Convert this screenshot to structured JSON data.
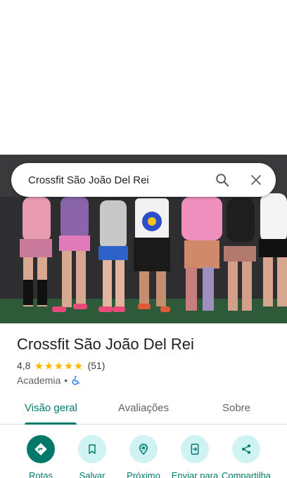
{
  "search": {
    "query": "Crossfit São João Del Rei"
  },
  "place": {
    "name": "Crossfit São João Del Rei",
    "rating": "4,8",
    "rating_value": 4.8,
    "stars": 5,
    "review_count": "(51)",
    "category": "Academia",
    "separator": "•",
    "accessibility_icon": "wheelchair-icon"
  },
  "tabs": [
    {
      "label": "Visão geral",
      "active": true
    },
    {
      "label": "Avaliações",
      "active": false
    },
    {
      "label": "Sobre",
      "active": false
    }
  ],
  "actions": [
    {
      "label": "Rotas",
      "icon": "directions-icon",
      "primary": true
    },
    {
      "label": "Salvar",
      "icon": "bookmark-icon",
      "primary": false
    },
    {
      "label": "Próximo",
      "icon": "nearby-icon",
      "primary": false
    },
    {
      "label": "Enviar para",
      "icon": "send-to-phone-icon",
      "primary": false
    },
    {
      "label": "Compartilha",
      "icon": "share-icon",
      "primary": false
    }
  ],
  "colors": {
    "accent": "#00796b",
    "action_bg": "#cff3f3",
    "star": "#fbbc04",
    "accessibility": "#1a73e8"
  }
}
